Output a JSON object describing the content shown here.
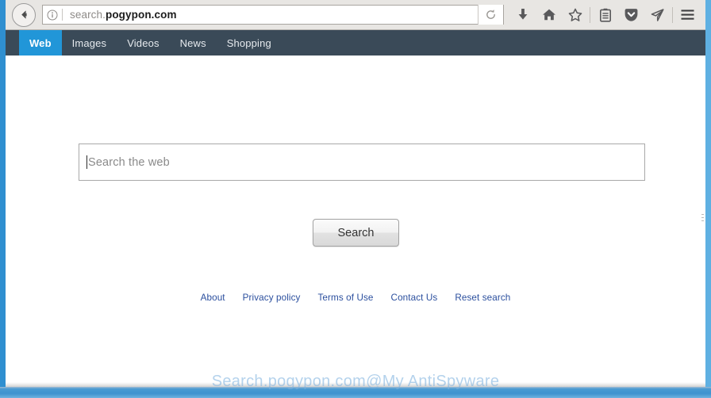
{
  "browser": {
    "back_button": "back-arrow",
    "url_prefix": "search.",
    "url_domain": "pogypon.com",
    "reload_title": "Reload",
    "toolbar_icons": [
      {
        "name": "download-icon",
        "label": "Downloads"
      },
      {
        "name": "home-icon",
        "label": "Home"
      },
      {
        "name": "bookmark-star-icon",
        "label": "Bookmark"
      },
      {
        "name": "library-icon",
        "label": "Library"
      },
      {
        "name": "pocket-icon",
        "label": "Save to Pocket"
      },
      {
        "name": "send-tab-icon",
        "label": "Send Tab"
      },
      {
        "name": "hamburger-menu-icon",
        "label": "Open menu"
      }
    ]
  },
  "site_nav": {
    "items": [
      {
        "label": "Web",
        "active": true
      },
      {
        "label": "Images",
        "active": false
      },
      {
        "label": "Videos",
        "active": false
      },
      {
        "label": "News",
        "active": false
      },
      {
        "label": "Shopping",
        "active": false
      }
    ],
    "active_bg": "#2196d8",
    "bar_bg": "#3a4a58"
  },
  "search": {
    "placeholder": "Search the web",
    "value": "",
    "button_label": "Search"
  },
  "footer": {
    "links": [
      "About",
      "Privacy policy",
      "Terms of Use",
      "Contact Us",
      "Reset search"
    ],
    "link_color": "#2b4f9e"
  },
  "watermark": {
    "text": "Search.pogypon.com@My AntiSpyware"
  },
  "colors": {
    "frame_blue": "#3c9ad8",
    "chrome_bg": "#e8e6e3",
    "accent": "#2196d8"
  }
}
